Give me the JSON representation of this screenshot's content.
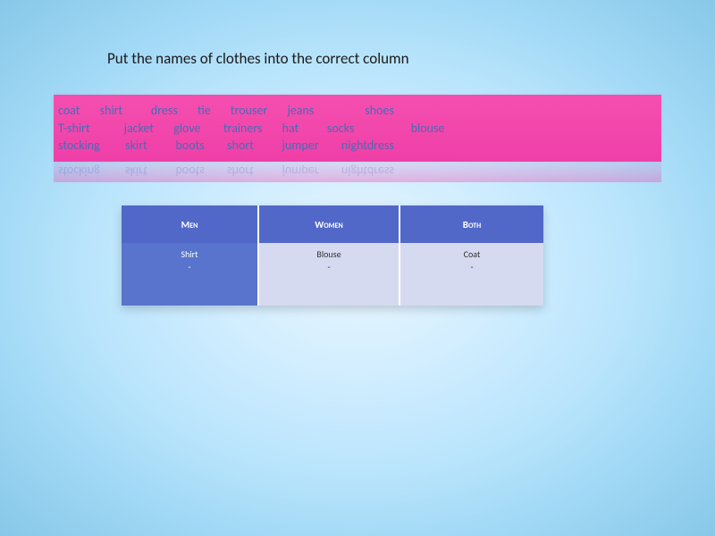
{
  "title": "Put the names of clothes into the correct column",
  "word_bank": {
    "line1": "coat       shirt          dress       tie       trouser       jeans                  shoes",
    "line2": "T-shirt            jacket       glove        trainers       hat          socks                    blouse",
    "line3": "stocking         skirt          boots        short          jumper        nightdress"
  },
  "reflection_line": "stocking         skirt          boots        short          jumper        nightdress",
  "table": {
    "headers": {
      "men": "Men",
      "women": "Women",
      "both": "Both"
    },
    "row1": {
      "men": {
        "a": "Shirt",
        "b": "-"
      },
      "women": {
        "a": "Blouse",
        "b": "-"
      },
      "both": {
        "a": "Coat",
        "b": "-"
      }
    }
  }
}
